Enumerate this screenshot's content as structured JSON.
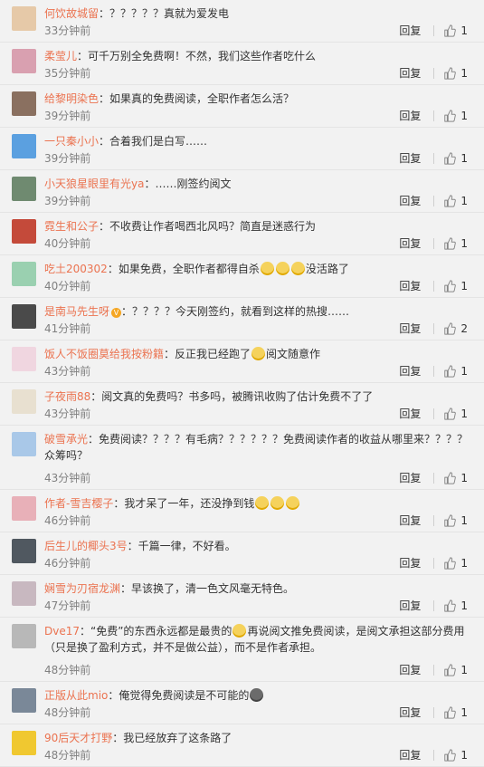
{
  "actions": {
    "reply_label": "回复"
  },
  "colors": {
    "author": "#eb7350",
    "time": "#808080",
    "background": "#f2f2f2"
  },
  "comments": [
    {
      "avatar_color": "#e6c9a8",
      "author": "何饮故城留",
      "text": "：？？？？？真就为爱发电",
      "time": "33分钟前",
      "likes": "1"
    },
    {
      "avatar_color": "#d9a0b0",
      "author": "柔莹儿",
      "text": "：可千万别全免费啊！不然，我们这些作者吃什么",
      "time": "35分钟前",
      "likes": "1"
    },
    {
      "avatar_color": "#8a7060",
      "author": "给黎明染色",
      "text": "：如果真的免费阅读，全职作者怎么活？",
      "time": "39分钟前",
      "likes": "1"
    },
    {
      "avatar_color": "#5ba0e0",
      "author": "一只秦小小",
      "text": "：合着我们是白写……",
      "time": "39分钟前",
      "likes": "1"
    },
    {
      "avatar_color": "#6f8a70",
      "author": "小天狼星眼里有光ya",
      "text": "：……刚签约阅文",
      "time": "39分钟前",
      "likes": "1"
    },
    {
      "avatar_color": "#c44a3a",
      "author": "霓生和公子",
      "text": "：不收费让作者喝西北风吗？简直是迷惑行为",
      "time": "40分钟前",
      "likes": "1"
    },
    {
      "avatar_color": "#9ad0b0",
      "author": "吃土200302",
      "text": "：如果免费，全职作者都得自杀",
      "text_after": "没活路了",
      "emoji_count": 3,
      "time": "40分钟前",
      "likes": "1"
    },
    {
      "avatar_color": "#4a4a4a",
      "author": "是南马先生呀",
      "verified": "V",
      "text": "：？？？？今天刚签约，就看到这样的热搜……",
      "time": "41分钟前",
      "likes": "2"
    },
    {
      "avatar_color": "#f0d6e0",
      "author": "饭人不饭圈莫给我按粉籍",
      "text": "：反正我已经跑了",
      "text_after": "阅文随意作",
      "emoji_count": 1,
      "time": "43分钟前",
      "likes": "1"
    },
    {
      "avatar_color": "#e8e0d0",
      "author": "子夜雨88",
      "text": "：阅文真的免费吗？书多吗，被腾讯收购了估计免费不了了",
      "time": "43分钟前",
      "likes": "1"
    },
    {
      "avatar_color": "#a9c8e8",
      "author": "破雪承光",
      "text": "：免费阅读？？？？有毛病？？？？？？免费阅读作者的收益从哪里来？？？？众筹吗？",
      "time": "43分钟前",
      "likes": "1"
    },
    {
      "avatar_color": "#e8b0b8",
      "author": "作者-雪吉樱子",
      "text": "：我才呆了一年，还没挣到钱",
      "emoji_count": 3,
      "time": "46分钟前",
      "likes": "1"
    },
    {
      "avatar_color": "#505860",
      "author": "后生儿的椰头3号",
      "text": "：千篇一律，不好看。",
      "time": "46分钟前",
      "likes": "1"
    },
    {
      "avatar_color": "#c8b8c0",
      "author": "娴雪为刃宿龙渊",
      "text": "：早该换了，清一色文风毫无特色。",
      "time": "47分钟前",
      "likes": "1"
    },
    {
      "avatar_color": "#b8b8b8",
      "author": "Dve17",
      "text": "：“免费”的东西永远都是最贵的",
      "text_after": "再说阅文推免费阅读，是阅文承担这部分费用（只是换了盈利方式，并不是做公益），而不是作者承担。",
      "emoji_count": 1,
      "time": "48分钟前",
      "likes": "1"
    },
    {
      "avatar_color": "#7a8898",
      "author": "正版从此mio",
      "text": "：俺觉得免费阅读是不可能的",
      "emoji_count": 1,
      "emoji_dark": true,
      "time": "48分钟前",
      "likes": "1"
    },
    {
      "avatar_color": "#f0c830",
      "author": "90后天才打野",
      "text": "：我已经放弃了这条路了",
      "time": "48分钟前",
      "likes": "1"
    }
  ]
}
